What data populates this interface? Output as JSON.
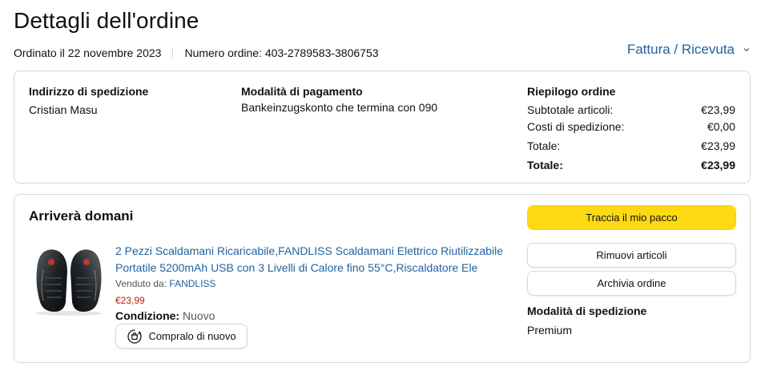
{
  "header": {
    "title": "Dettagli dell'ordine",
    "ordered_on": "Ordinato il 22 novembre 2023",
    "order_number": "Numero ordine: 403-2789583-3806753",
    "invoice_label": "Fattura / Ricevuta"
  },
  "summary": {
    "shipping_address": {
      "title": "Indirizzo di spedizione",
      "name": "Cristian Masu"
    },
    "payment": {
      "title": "Modalità di pagamento",
      "method": "Bankeinzugskonto che termina con 090"
    },
    "order_summary": {
      "title": "Riepilogo ordine",
      "rows": [
        {
          "label": "Subtotale articoli:",
          "value": "€23,99"
        },
        {
          "label": "Costi di spedizione:",
          "value": "€0,00"
        },
        {
          "label": "Totale:",
          "value": "€23,99"
        }
      ],
      "grand_total": {
        "label": "Totale:",
        "value": "€23,99"
      }
    }
  },
  "shipment": {
    "status": "Arriverà domani",
    "product": {
      "title": "2 Pezzi Scaldamani Ricaricabile,FANDLISS Scaldamani Elettrico Riutilizzabile Portatile 5200mAh USB con 3 Livelli di Calore fino 55°C,Riscaldatore Ele",
      "sold_by_label": "Venduto da:",
      "seller": "FANDLISS",
      "price": "€23,99",
      "condition_label": "Condizione:",
      "condition_value": "Nuovo",
      "buy_again_label": "Compralo di nuovo"
    },
    "actions": {
      "track": "Traccia il mio pacco",
      "remove": "Rimuovi articoli",
      "archive": "Archivia ordine"
    },
    "shipping_mode": {
      "title": "Modalità di spedizione",
      "value": "Premium"
    }
  },
  "colors": {
    "link": "#2162a1",
    "price": "#b12704",
    "track_button": "#ffd814",
    "border": "#d5d9d9"
  },
  "icons": [
    "chevron-down-icon",
    "buy-again-icon"
  ]
}
